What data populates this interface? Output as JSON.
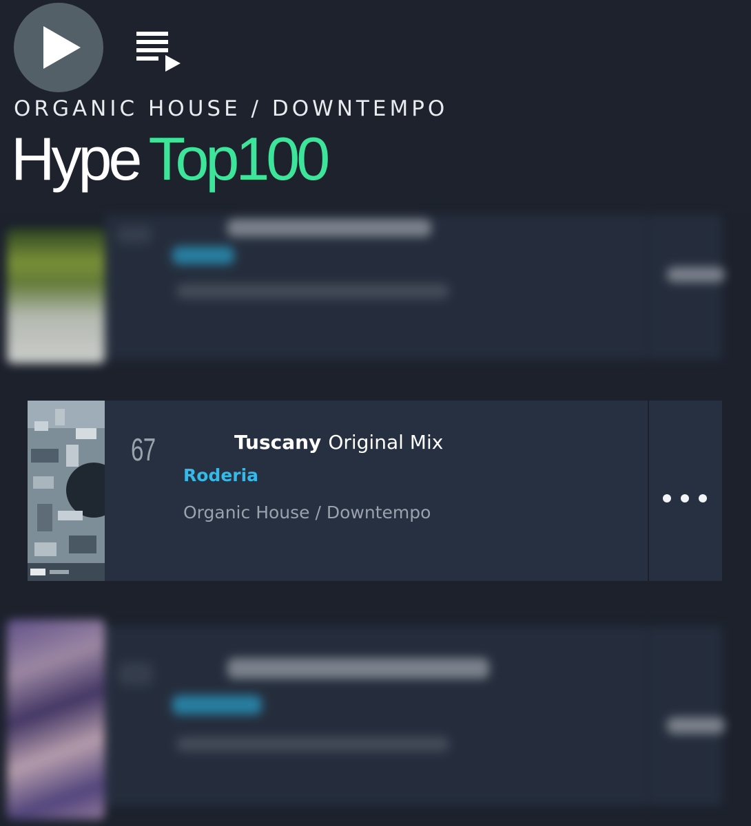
{
  "header": {
    "genre_label": "ORGANIC HOUSE / DOWNTEMPO",
    "title_hype": "Hype",
    "title_top": "Top100",
    "play_icon": "play-icon",
    "queue_icon": "add-to-queue-icon"
  },
  "tracks": [
    {
      "rank": "67",
      "name": "Tuscany",
      "mix": "Original Mix",
      "artist": "Roderia",
      "genre": "Organic House / Downtempo",
      "more_icon": "more-options-icon"
    }
  ],
  "colors": {
    "background": "#1c212c",
    "card": "#273040",
    "accent_green": "#3de59b",
    "artist_blue": "#36b9e7",
    "muted_text": "#9aa2ad"
  }
}
